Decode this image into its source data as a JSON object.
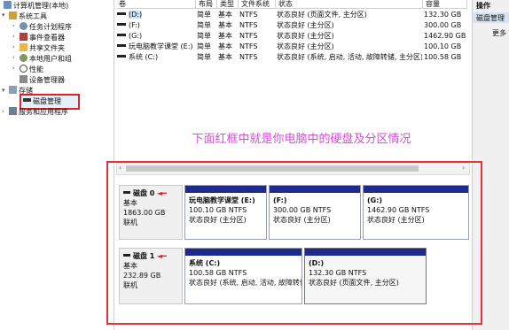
{
  "tree": {
    "root": "计算机管理(本地)",
    "system_tools": "系统工具",
    "task_scheduler": "任务计划程序",
    "event_viewer": "事件查看器",
    "shared_folders": "共享文件夹",
    "local_users": "本地用户和组",
    "performance": "性能",
    "device_manager": "设备管理器",
    "storage": "存储",
    "disk_management": "磁盘管理",
    "services": "服务和应用程序"
  },
  "list": {
    "headers": [
      "卷",
      "布局",
      "类型",
      "文件系统",
      "状态",
      "容量"
    ],
    "rows": [
      {
        "vol": "(D:)",
        "layout": "简单",
        "type": "基本",
        "fs": "NTFS",
        "status": "状态良好 (页面文件, 主分区)",
        "cap": "132.30 GB"
      },
      {
        "vol": "(F:)",
        "layout": "简单",
        "type": "基本",
        "fs": "NTFS",
        "status": "状态良好 (主分区)",
        "cap": "300.00 GB"
      },
      {
        "vol": "(G:)",
        "layout": "简单",
        "type": "基本",
        "fs": "NTFS",
        "status": "状态良好 (主分区)",
        "cap": "1462.90 GB"
      },
      {
        "vol": "玩电脑教学课堂 (E:)",
        "layout": "简单",
        "type": "基本",
        "fs": "NTFS",
        "status": "状态良好 (主分区)",
        "cap": "100.10 GB"
      },
      {
        "vol": "系统 (C:)",
        "layout": "简单",
        "type": "基本",
        "fs": "NTFS",
        "status": "状态良好 (系统, 启动, 活动, 故障转储, 主分区)",
        "cap": "100.58 GB"
      }
    ]
  },
  "actions": {
    "title": "操作",
    "item1": "磁盘管理",
    "item2": "更多"
  },
  "annotation": "下面红框中就是你电脑中的硬盘及分区情况",
  "disks": [
    {
      "name": "磁盘 0",
      "type": "基本",
      "size": "1863.00 GB",
      "state": "联机",
      "parts": [
        {
          "name": "玩电脑教学课堂 (E:)",
          "size": "100.10 GB NTFS",
          "status": "状态良好 (主分区)"
        },
        {
          "name": "(F:)",
          "size": "300.00 GB NTFS",
          "status": "状态良好 (主分区)"
        },
        {
          "name": "(G:)",
          "size": "1462.90 GB NTFS",
          "status": "状态良好 (主分区)"
        }
      ]
    },
    {
      "name": "磁盘 1",
      "type": "基本",
      "size": "232.89 GB",
      "state": "联机",
      "parts": [
        {
          "name": "系统 (C:)",
          "size": "100.58 GB NTFS",
          "status": "状态良好 (系统, 启动, 活动, 故障转储"
        },
        {
          "name": "(D:)",
          "size": "132.30 GB NTFS",
          "status": "状态良好 (页面文件, 主分区)"
        }
      ]
    }
  ],
  "colors": {
    "accent_partition": "#1e2a8a",
    "annotation_red": "#e0333a",
    "annotation_text": "#d04fd0"
  }
}
